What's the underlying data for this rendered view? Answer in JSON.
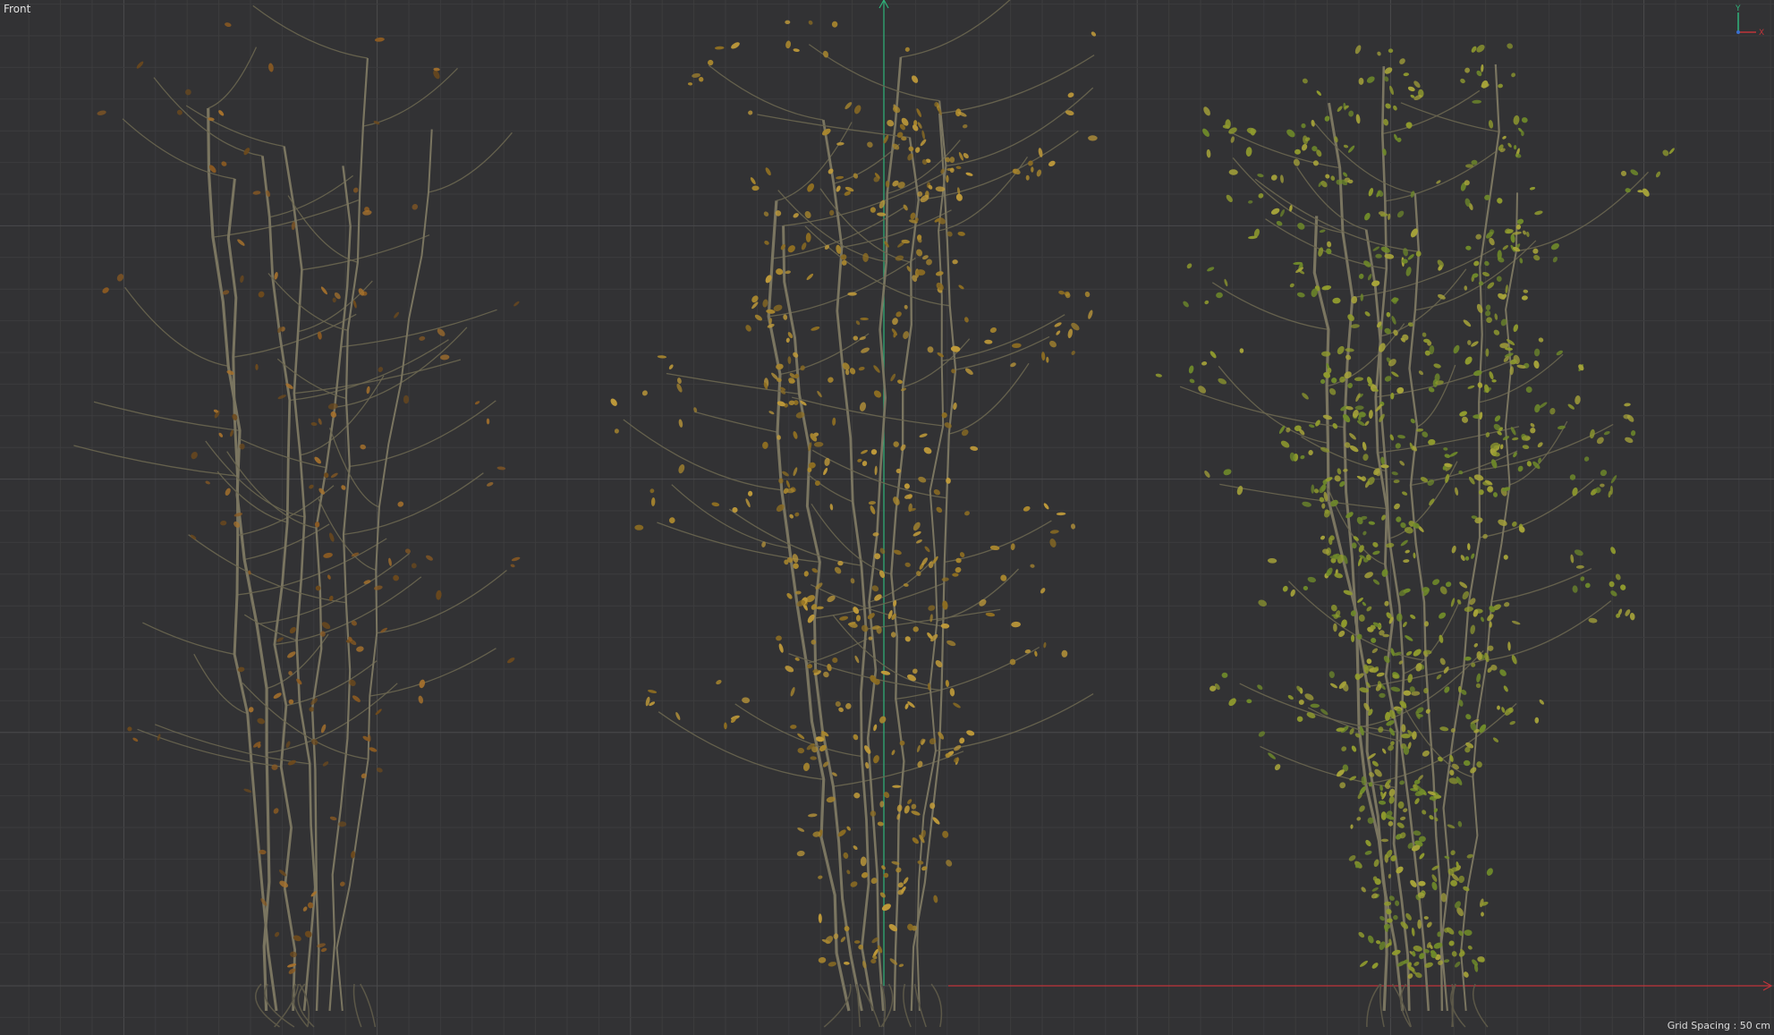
{
  "viewport": {
    "view_name": "Front",
    "grid_spacing_text": "Grid Spacing : 50 cm",
    "background_color": "#323234",
    "grid_minor_color": "#3c3c3e",
    "grid_major_color": "#4a4a4c",
    "axis_x_color": "#c0343a",
    "axis_y_color": "#2fb37a",
    "axis_z_color": "#3a6fd0"
  },
  "axis_gizmo": {
    "y_label": "Y",
    "x_label": "X",
    "icon": "axis-gizmo-icon"
  },
  "trees": [
    {
      "name": "tree-sparse-autumn",
      "foliage": "sparse",
      "leaf_colors": [
        "#8a5a22",
        "#a6712c",
        "#6e4a1c"
      ]
    },
    {
      "name": "tree-medium-autumn",
      "foliage": "medium",
      "leaf_colors": [
        "#a8862e",
        "#8d6d22",
        "#bf9a3a"
      ]
    },
    {
      "name": "tree-dense-green",
      "foliage": "dense",
      "leaf_colors": [
        "#8f9a2e",
        "#6f8a2a",
        "#a7a43a"
      ]
    }
  ]
}
